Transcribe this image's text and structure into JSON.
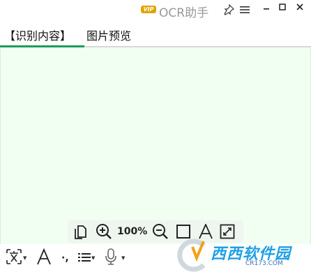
{
  "titlebar": {
    "vip_badge": "VIP",
    "app_title": "OCR助手",
    "icons": [
      "pin-icon",
      "menu-icon",
      "minimize-icon",
      "maximize-icon",
      "close-icon"
    ]
  },
  "tabs": [
    {
      "label": "【识别内容】",
      "active": true
    },
    {
      "label": "图片预览",
      "active": false
    }
  ],
  "content": {
    "text": ""
  },
  "float_toolbar": {
    "zoom_level": "100%",
    "icons": [
      "copy-icon",
      "zoom-in-icon",
      "zoom-out-icon",
      "select-box-icon",
      "text-icon",
      "fit-screen-icon"
    ]
  },
  "bottombar": {
    "icons": [
      "translate-icon",
      "font-icon",
      "punctuation-icon",
      "list-format-icon",
      "microphone-icon"
    ],
    "punctuation_label": "·,"
  },
  "watermark": {
    "main": "西西软件园",
    "sub": "CR173.COM"
  },
  "colors": {
    "accent_green": "#1d9b5a",
    "content_bg": "#f1fff2",
    "vip_gold": "#e0a400",
    "watermark_blue": "#1fa0e6"
  }
}
